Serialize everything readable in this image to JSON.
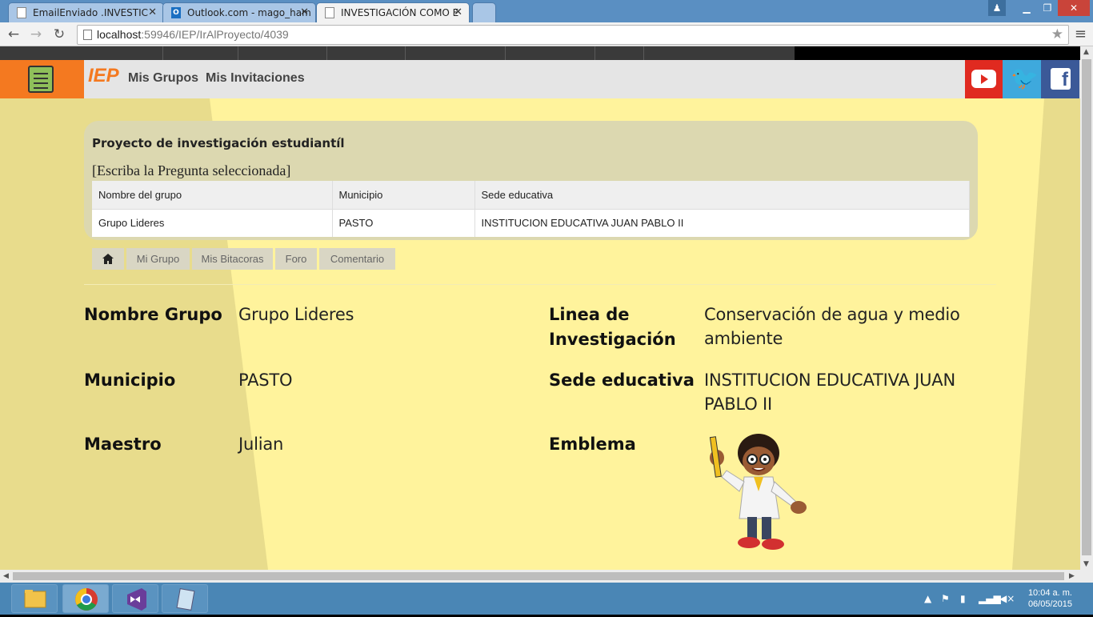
{
  "browser": {
    "tabs": [
      {
        "label": "EmailEnviado .INVESTIC",
        "icon": "page-icon"
      },
      {
        "label": "Outlook.com - mago_ham",
        "icon": "outlook-icon"
      },
      {
        "label": "INVESTIGACIÓN COMO E",
        "icon": "page-icon",
        "active": true
      }
    ],
    "url_host": "localhost",
    "url_path": ":59946/IEP/IrAlProyecto/4039",
    "window_controls": {
      "minimize": "▁",
      "maximize": "❐",
      "close": "✕"
    }
  },
  "site": {
    "brand": "IEP",
    "nav": [
      "Mis Grupos",
      "Mis Invitaciones"
    ],
    "social": [
      "youtube-icon",
      "twitter-icon",
      "facebook-icon"
    ],
    "accent": "#f47920",
    "background": "#fff39c"
  },
  "panel": {
    "title": "Proyecto de investigación estudiantíl",
    "question": "[Escriba la Pregunta seleccionada]",
    "table": {
      "headers": [
        "Nombre del grupo",
        "Municipio",
        "Sede educativa"
      ],
      "rows": [
        [
          "Grupo Lideres",
          "PASTO",
          "INSTITUCION EDUCATIVA JUAN PABLO II"
        ]
      ]
    }
  },
  "tabs": [
    {
      "label": "",
      "icon": "home-icon"
    },
    {
      "label": "Mi Grupo"
    },
    {
      "label": "Mis Bitacoras"
    },
    {
      "label": "Foro"
    },
    {
      "label": "Comentario"
    }
  ],
  "details": {
    "nombre_grupo_label": "Nombre Grupo",
    "nombre_grupo": "Grupo Lideres",
    "linea_label_1": "Linea de",
    "linea_label_2": "Investigación",
    "linea_1": "Conservación de agua y medio",
    "linea_2": "ambiente",
    "municipio_label": "Municipio",
    "municipio": "PASTO",
    "sede_label": "Sede educativa",
    "sede_1": "INSTITUCION EDUCATIVA JUAN",
    "sede_2": "PABLO II",
    "maestro_label": "Maestro",
    "maestro": "Julian",
    "emblema_label": "Emblema"
  },
  "taskbar": {
    "apps": [
      "file-explorer-icon",
      "chrome-icon",
      "visual-studio-icon",
      "notepad-icon"
    ],
    "time": "10:04 a. m.",
    "date": "06/05/2015"
  }
}
